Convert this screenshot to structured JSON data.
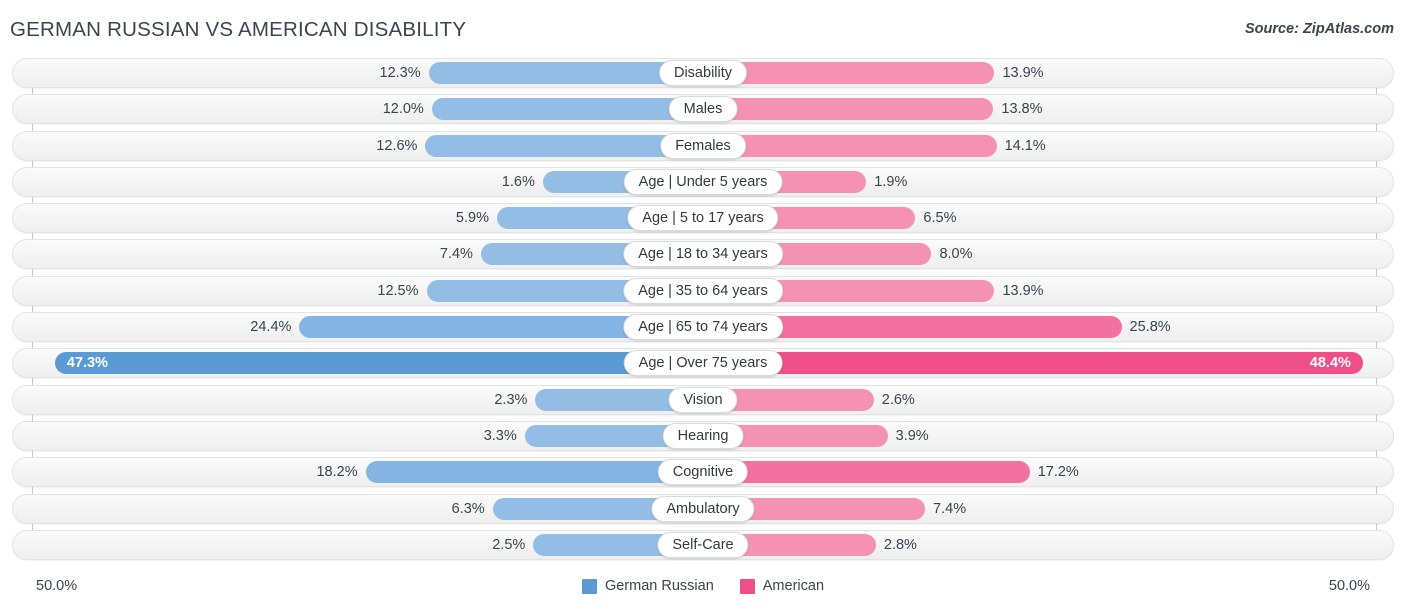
{
  "header": {
    "title": "GERMAN RUSSIAN VS AMERICAN DISABILITY",
    "source": "Source: ZipAtlas.com"
  },
  "footer": {
    "axis_left": "50.0%",
    "axis_right": "50.0%",
    "legend": [
      {
        "label": "German Russian",
        "color": "#5b9bd5"
      },
      {
        "label": "American",
        "color": "#ee4f86"
      }
    ]
  },
  "chart_data": {
    "type": "bar",
    "title": "GERMAN RUSSIAN VS AMERICAN DISABILITY",
    "orientation": "horizontal-diverging",
    "xlabel": "",
    "ylabel": "",
    "xlim": [
      50.0,
      50.0
    ],
    "axis_left_label": "50.0%",
    "axis_right_label": "50.0%",
    "grid": true,
    "legend_position": "bottom-center",
    "categories": [
      "Disability",
      "Males",
      "Females",
      "Age | Under 5 years",
      "Age | 5 to 17 years",
      "Age | 18 to 34 years",
      "Age | 35 to 64 years",
      "Age | 65 to 74 years",
      "Age | Over 75 years",
      "Vision",
      "Hearing",
      "Cognitive",
      "Ambulatory",
      "Self-Care"
    ],
    "series": [
      {
        "name": "German Russian",
        "color": "#94bde5",
        "values": [
          12.3,
          12.0,
          12.6,
          1.6,
          5.9,
          7.4,
          12.5,
          24.4,
          47.3,
          2.3,
          3.3,
          18.2,
          6.3,
          2.5
        ],
        "labels": [
          "12.3%",
          "12.0%",
          "12.6%",
          "1.6%",
          "5.9%",
          "7.4%",
          "12.5%",
          "24.4%",
          "47.3%",
          "2.3%",
          "3.3%",
          "18.2%",
          "6.3%",
          "2.5%"
        ]
      },
      {
        "name": "American",
        "color": "#f592b4",
        "values": [
          13.9,
          13.8,
          14.1,
          1.9,
          6.5,
          8.0,
          13.9,
          25.8,
          48.4,
          2.6,
          3.9,
          17.2,
          7.4,
          2.8
        ],
        "labels": [
          "13.9%",
          "13.8%",
          "14.1%",
          "1.9%",
          "6.5%",
          "8.0%",
          "13.9%",
          "25.8%",
          "48.4%",
          "2.6%",
          "3.9%",
          "17.2%",
          "7.4%",
          "2.8%"
        ]
      }
    ],
    "rows": [
      {
        "label": "Disability",
        "left_value": 12.3,
        "left_label": "12.3%",
        "right_value": 13.9,
        "right_label": "13.9%",
        "emphasis": "normal"
      },
      {
        "label": "Males",
        "left_value": 12.0,
        "left_label": "12.0%",
        "right_value": 13.8,
        "right_label": "13.8%",
        "emphasis": "normal"
      },
      {
        "label": "Females",
        "left_value": 12.6,
        "left_label": "12.6%",
        "right_value": 14.1,
        "right_label": "14.1%",
        "emphasis": "normal"
      },
      {
        "label": "Age | Under 5 years",
        "left_value": 1.6,
        "left_label": "1.6%",
        "right_value": 1.9,
        "right_label": "1.9%",
        "emphasis": "normal"
      },
      {
        "label": "Age | 5 to 17 years",
        "left_value": 5.9,
        "left_label": "5.9%",
        "right_value": 6.5,
        "right_label": "6.5%",
        "emphasis": "normal"
      },
      {
        "label": "Age | 18 to 34 years",
        "left_value": 7.4,
        "left_label": "7.4%",
        "right_value": 8.0,
        "right_label": "8.0%",
        "emphasis": "normal"
      },
      {
        "label": "Age | 35 to 64 years",
        "left_value": 12.5,
        "left_label": "12.5%",
        "right_value": 13.9,
        "right_label": "13.9%",
        "emphasis": "normal"
      },
      {
        "label": "Age | 65 to 74 years",
        "left_value": 24.4,
        "left_label": "24.4%",
        "right_value": 25.8,
        "right_label": "25.8%",
        "emphasis": "mid"
      },
      {
        "label": "Age | Over 75 years",
        "left_value": 47.3,
        "left_label": "47.3%",
        "right_value": 48.4,
        "right_label": "48.4%",
        "emphasis": "strong"
      },
      {
        "label": "Vision",
        "left_value": 2.3,
        "left_label": "2.3%",
        "right_value": 2.6,
        "right_label": "2.6%",
        "emphasis": "normal"
      },
      {
        "label": "Hearing",
        "left_value": 3.3,
        "left_label": "3.3%",
        "right_value": 3.9,
        "right_label": "3.9%",
        "emphasis": "normal"
      },
      {
        "label": "Cognitive",
        "left_value": 18.2,
        "left_label": "18.2%",
        "right_value": 17.2,
        "right_label": "17.2%",
        "emphasis": "mid"
      },
      {
        "label": "Ambulatory",
        "left_value": 6.3,
        "left_label": "6.3%",
        "right_value": 7.4,
        "right_label": "7.4%",
        "emphasis": "normal"
      },
      {
        "label": "Self-Care",
        "left_value": 2.5,
        "left_label": "2.5%",
        "right_value": 2.8,
        "right_label": "2.8%",
        "emphasis": "normal"
      }
    ]
  }
}
